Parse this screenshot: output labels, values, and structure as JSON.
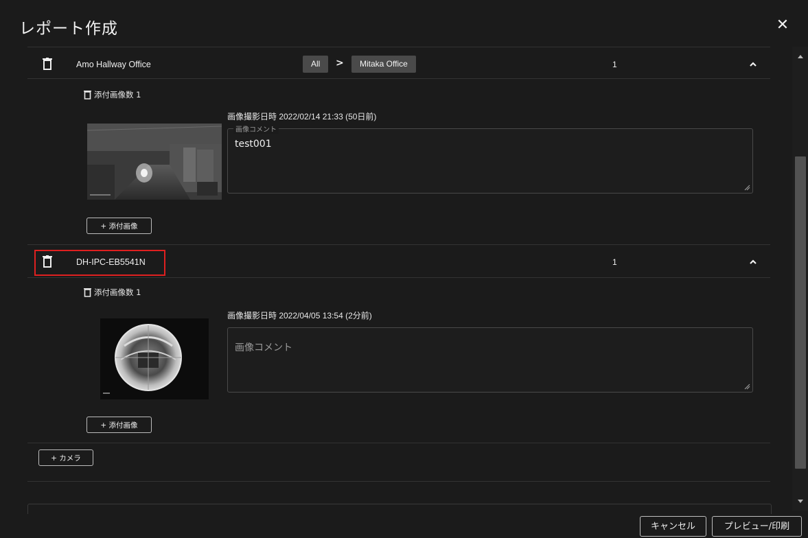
{
  "dialog": {
    "title": "レポート作成",
    "close_icon": "close-icon"
  },
  "cameras": [
    {
      "name": "Amo Hallway Office",
      "breadcrumb": [
        "All",
        "Mitaka Office"
      ],
      "count": "1",
      "attach_label": "添付画像数 1",
      "shot_time": "画像撮影日時 2022/02/14 21:33 (50日前)",
      "comment_label": "画像コメント",
      "comment_value": "test001",
      "add_image_label": "+ 添付画像"
    },
    {
      "name": "DH-IPC-EB5541N",
      "count": "1",
      "attach_label": "添付画像数 1",
      "shot_time": "画像撮影日時 2022/04/05 13:54 (2分前)",
      "comment_placeholder": "画像コメント",
      "add_image_label": "+ 添付画像"
    }
  ],
  "add_camera_label": "+ カメラ",
  "footer": {
    "cancel_label": "キャンセル",
    "preview_label": "プレビュー/印刷"
  },
  "colors": {
    "background": "#1b1b1b",
    "chip": "#4a4a4a",
    "highlight": "#e02020"
  }
}
